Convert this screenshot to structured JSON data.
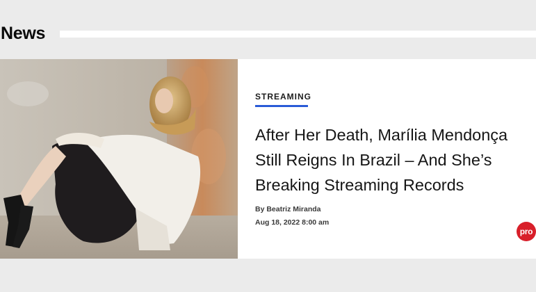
{
  "section": {
    "title": "News"
  },
  "article": {
    "image": {
      "icon": "photo-of-woman-seated-against-wall"
    },
    "category": "STREAMING",
    "headline": "After Her Death, Marília Mendonça Still Reigns In Brazil – And She’s Breaking Streaming Records",
    "byline": "By Beatriz Miranda",
    "date": "Aug 18, 2022 8:00 am",
    "badge": "pro"
  },
  "colors": {
    "accent_underline": "#2a5bd7",
    "badge": "#d81f2a",
    "page_background": "#ebebeb"
  }
}
